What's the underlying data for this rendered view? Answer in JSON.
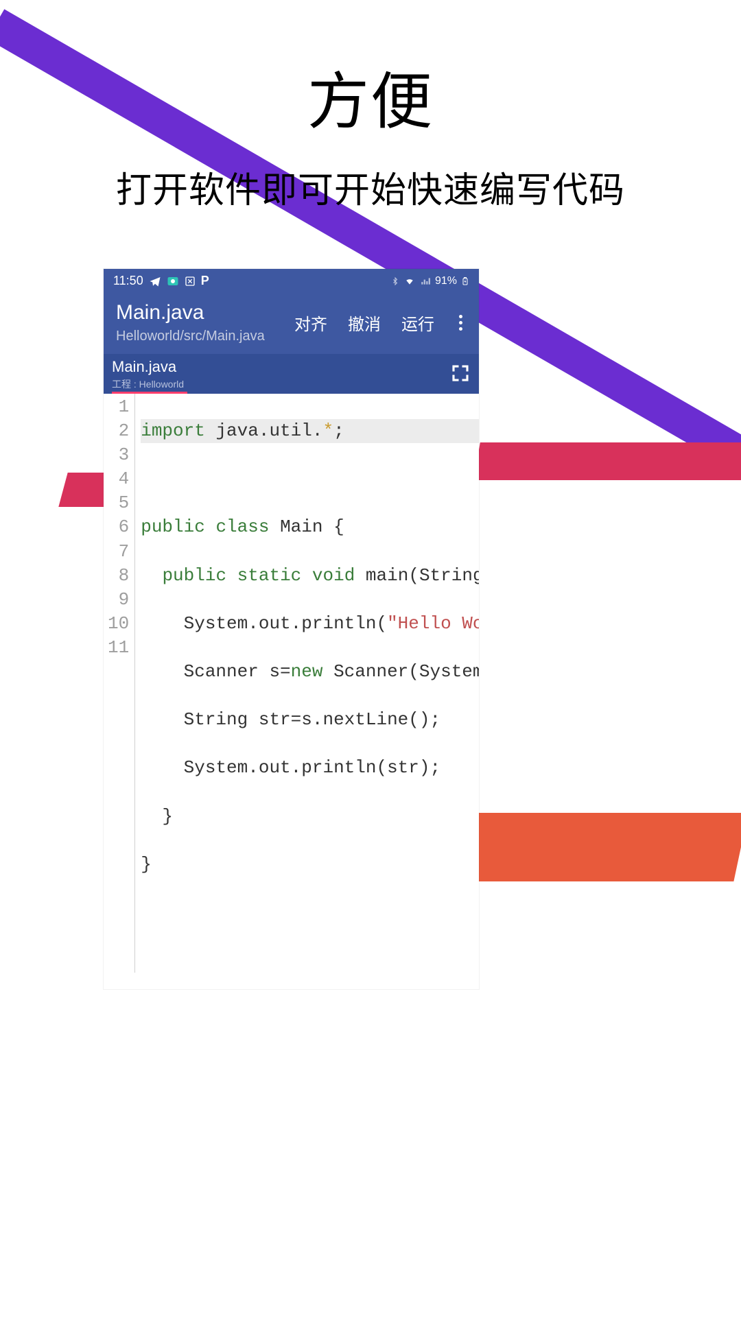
{
  "hero": {
    "title": "方便",
    "subtitle": "打开软件即可开始快速编写代码"
  },
  "status": {
    "time": "11:50",
    "battery": "91%"
  },
  "appbar": {
    "title": "Main.java",
    "path": "Helloworld/src/Main.java",
    "actions": {
      "align": "对齐",
      "undo": "撤消",
      "run": "运行"
    }
  },
  "tab": {
    "name": "Main.java",
    "project_label": "工程 : Helloworld"
  },
  "code": {
    "lines": [
      "1",
      "2",
      "3",
      "4",
      "5",
      "6",
      "7",
      "8",
      "9",
      "10",
      "11"
    ],
    "l1": {
      "kw": "import",
      "rest": " java.util.",
      "star": "*",
      "semi": ";"
    },
    "l3": {
      "a": "public",
      "b": "class",
      "name": " Main {"
    },
    "l4": {
      "a": "public",
      "b": "static",
      "c": "void",
      "rest": " main(String[]"
    },
    "l5": {
      "pre": "    System.out.println(",
      "str": "\"Hello World"
    },
    "l6": {
      "pre": "    Scanner s=",
      "kw": "new",
      "rest": " Scanner(System.in"
    },
    "l7": "    String str=s.nextLine();",
    "l8": "    System.out.println(str);",
    "l9": "  }",
    "l10": "}"
  }
}
